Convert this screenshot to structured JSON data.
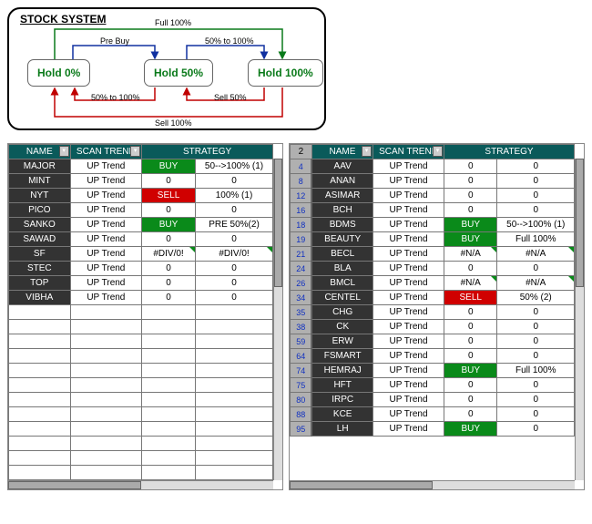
{
  "diagram": {
    "title": "STOCK SYSTEM",
    "box0": "Hold 0%",
    "box50": "Hold 50%",
    "box100": "Hold 100%",
    "label_full": "Full 100%",
    "label_prebuy": "Pre Buy",
    "label_50_100_top": "50% to 100%",
    "label_50_100_bot": "50% to 100%",
    "label_sell50": "Sell 50%",
    "label_sell100": "Sell 100%"
  },
  "headers": {
    "rownum": "2",
    "name": "NAME",
    "scan": "SCAN TREND",
    "strategy": "STRATEGY"
  },
  "left_rows": [
    {
      "name": "MAJOR",
      "scan": "UP Trend",
      "sig": "BUY",
      "sigc": "buy",
      "val": "50-->100% (1)"
    },
    {
      "name": "MINT",
      "scan": "UP Trend",
      "sig": "0",
      "sigc": "",
      "val": "0"
    },
    {
      "name": "NYT",
      "scan": "UP Trend",
      "sig": "SELL",
      "sigc": "sell",
      "val": "100% (1)"
    },
    {
      "name": "PICO",
      "scan": "UP Trend",
      "sig": "0",
      "sigc": "",
      "val": "0"
    },
    {
      "name": "SANKO",
      "scan": "UP Trend",
      "sig": "BUY",
      "sigc": "buy",
      "val": "PRE 50%(2)"
    },
    {
      "name": "SAWAD",
      "scan": "UP Trend",
      "sig": "0",
      "sigc": "",
      "val": "0"
    },
    {
      "name": "SF",
      "scan": "UP Trend",
      "sig": "#DIV/0!",
      "sigc": "flag",
      "val": "#DIV/0!",
      "valflag": true
    },
    {
      "name": "STEC",
      "scan": "UP Trend",
      "sig": "0",
      "sigc": "",
      "val": "0"
    },
    {
      "name": "TOP",
      "scan": "UP Trend",
      "sig": "0",
      "sigc": "",
      "val": "0"
    },
    {
      "name": "VIBHA",
      "scan": "UP Trend",
      "sig": "0",
      "sigc": "",
      "val": "0"
    }
  ],
  "left_empty": 12,
  "right_rows": [
    {
      "n": "4",
      "name": "AAV",
      "scan": "UP Trend",
      "sig": "0",
      "sigc": "",
      "val": "0"
    },
    {
      "n": "8",
      "name": "ANAN",
      "scan": "UP Trend",
      "sig": "0",
      "sigc": "",
      "val": "0"
    },
    {
      "n": "12",
      "name": "ASIMAR",
      "scan": "UP Trend",
      "sig": "0",
      "sigc": "",
      "val": "0"
    },
    {
      "n": "16",
      "name": "BCH",
      "scan": "UP Trend",
      "sig": "0",
      "sigc": "",
      "val": "0"
    },
    {
      "n": "18",
      "name": "BDMS",
      "scan": "UP Trend",
      "sig": "BUY",
      "sigc": "buy",
      "val": "50-->100% (1)"
    },
    {
      "n": "19",
      "name": "BEAUTY",
      "scan": "UP Trend",
      "sig": "BUY",
      "sigc": "buy",
      "val": "Full 100%"
    },
    {
      "n": "21",
      "name": "BECL",
      "scan": "UP Trend",
      "sig": "#N/A",
      "sigc": "flag",
      "val": "#N/A",
      "valflag": true
    },
    {
      "n": "24",
      "name": "BLA",
      "scan": "UP Trend",
      "sig": "0",
      "sigc": "",
      "val": "0"
    },
    {
      "n": "26",
      "name": "BMCL",
      "scan": "UP Trend",
      "sig": "#N/A",
      "sigc": "flag",
      "val": "#N/A",
      "valflag": true
    },
    {
      "n": "34",
      "name": "CENTEL",
      "scan": "UP Trend",
      "sig": "SELL",
      "sigc": "sell",
      "val": "50% (2)"
    },
    {
      "n": "35",
      "name": "CHG",
      "scan": "UP Trend",
      "sig": "0",
      "sigc": "",
      "val": "0"
    },
    {
      "n": "38",
      "name": "CK",
      "scan": "UP Trend",
      "sig": "0",
      "sigc": "",
      "val": "0"
    },
    {
      "n": "59",
      "name": "ERW",
      "scan": "UP Trend",
      "sig": "0",
      "sigc": "",
      "val": "0"
    },
    {
      "n": "64",
      "name": "FSMART",
      "scan": "UP Trend",
      "sig": "0",
      "sigc": "",
      "val": "0"
    },
    {
      "n": "74",
      "name": "HEMRAJ",
      "scan": "UP Trend",
      "sig": "BUY",
      "sigc": "buy",
      "val": "Full 100%"
    },
    {
      "n": "75",
      "name": "HFT",
      "scan": "UP Trend",
      "sig": "0",
      "sigc": "",
      "val": "0"
    },
    {
      "n": "80",
      "name": "IRPC",
      "scan": "UP Trend",
      "sig": "0",
      "sigc": "",
      "val": "0"
    },
    {
      "n": "88",
      "name": "KCE",
      "scan": "UP Trend",
      "sig": "0",
      "sigc": "",
      "val": "0"
    },
    {
      "n": "95",
      "name": "LH",
      "scan": "UP Trend",
      "sig": "BUY",
      "sigc": "buy",
      "val": "0"
    }
  ]
}
